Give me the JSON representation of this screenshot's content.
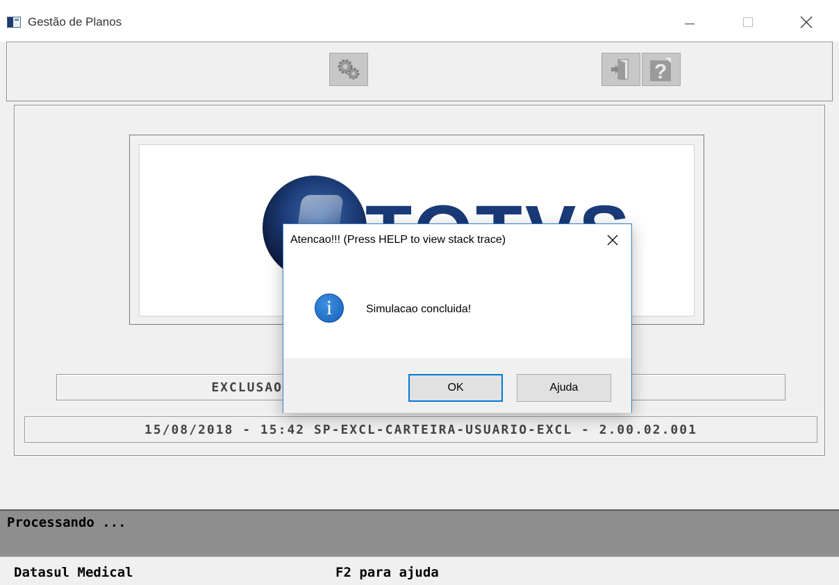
{
  "window": {
    "title": "Gestão de Planos",
    "icon": "app-window-icon"
  },
  "toolbar": {
    "buttons": [
      "gears-icon",
      "exit-door-icon",
      "help-question-icon"
    ]
  },
  "logo": {
    "text": "TOTVS"
  },
  "info": {
    "bar1": "EXCLUSAO DE CARTEIRA DE USUARIO COM SITUACAO 90",
    "bar2": "15/08/2018 - 15:42  SP-EXCL-CARTEIRA-USUARIO-EXCL - 2.00.02.001"
  },
  "status": {
    "text": "Processando ..."
  },
  "footer": {
    "left": "Datasul Medical",
    "mid": "F2 para ajuda"
  },
  "dialog": {
    "title": "Atencao!!! (Press HELP to view stack trace)",
    "message": "Simulacao concluida!",
    "ok_label": "OK",
    "help_label": "Ajuda",
    "icon": "info-icon",
    "accent": "#0078d7"
  }
}
